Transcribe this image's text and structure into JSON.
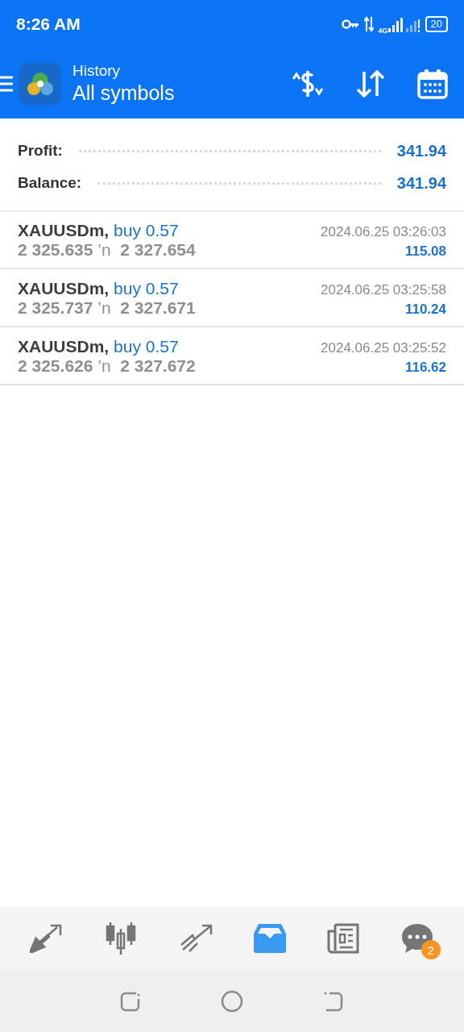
{
  "status_bar": {
    "time": "8:26 AM",
    "network": "4G",
    "battery": "20"
  },
  "app_bar": {
    "title": "History",
    "subtitle": "All symbols"
  },
  "summary": [
    {
      "label": "Profit:",
      "value": "341.94"
    },
    {
      "label": "Balance:",
      "value": "341.94"
    }
  ],
  "deals": [
    {
      "symbol": "XAUUSDm,",
      "action": "buy 0.57",
      "open_price": "2 325.635",
      "arrow": "’n",
      "close_price": "2 327.654",
      "time": "2024.06.25 03:26:03",
      "profit": "115.08"
    },
    {
      "symbol": "XAUUSDm,",
      "action": "buy 0.57",
      "open_price": "2 325.737",
      "arrow": "’n",
      "close_price": "2 327.671",
      "time": "2024.06.25 03:25:58",
      "profit": "110.24"
    },
    {
      "symbol": "XAUUSDm,",
      "action": "buy 0.57",
      "open_price": "2 325.626",
      "arrow": "’n",
      "close_price": "2 327.672",
      "time": "2024.06.25 03:25:52",
      "profit": "116.62"
    }
  ],
  "bottom_nav": [
    {
      "kind": "quotes",
      "selected": false
    },
    {
      "kind": "chart",
      "selected": false
    },
    {
      "kind": "trade",
      "selected": false
    },
    {
      "kind": "history",
      "selected": true
    },
    {
      "kind": "news",
      "selected": false
    },
    {
      "kind": "messages",
      "selected": false,
      "badge": "2"
    }
  ]
}
